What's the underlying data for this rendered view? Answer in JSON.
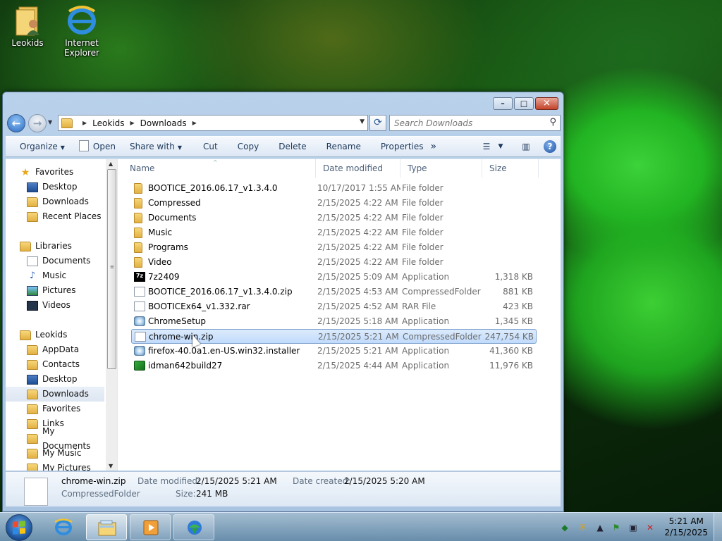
{
  "desktop": {
    "icons": [
      {
        "label": "Leokids",
        "icon": "user-folder-icon"
      },
      {
        "label": "Internet\nExplorer",
        "icon": "internet-explorer-icon"
      }
    ]
  },
  "window": {
    "caption_buttons": {
      "minimize": "–",
      "maximize": "□",
      "close": "✕"
    },
    "nav": {
      "back": "←",
      "forward": "→"
    },
    "address": {
      "crumbs": [
        "Leokids",
        "Downloads"
      ]
    },
    "search": {
      "placeholder": "Search Downloads"
    },
    "toolbar": {
      "organize": "Organize",
      "open": "Open",
      "share_with": "Share with",
      "cut": "Cut",
      "copy": "Copy",
      "delete": "Delete",
      "rename": "Rename",
      "properties": "Properties",
      "more": "»",
      "help": "?"
    },
    "nav_pane": {
      "items": [
        {
          "label": "Favorites",
          "icon": "star-icon",
          "level": 0
        },
        {
          "label": "Desktop",
          "icon": "desktop-icon",
          "level": 1
        },
        {
          "label": "Downloads",
          "icon": "downloads-folder-icon",
          "level": 1
        },
        {
          "label": "Recent Places",
          "icon": "recent-places-icon",
          "level": 1
        },
        {
          "label": "Libraries",
          "icon": "libraries-icon",
          "level": 0
        },
        {
          "label": "Documents",
          "icon": "documents-icon",
          "level": 1
        },
        {
          "label": "Music",
          "icon": "music-icon",
          "level": 1
        },
        {
          "label": "Pictures",
          "icon": "pictures-icon",
          "level": 1
        },
        {
          "label": "Videos",
          "icon": "videos-icon",
          "level": 1
        },
        {
          "label": "Leokids",
          "icon": "user-folder-icon",
          "level": 0
        },
        {
          "label": "AppData",
          "icon": "folder-icon",
          "level": 1
        },
        {
          "label": "Contacts",
          "icon": "contacts-icon",
          "level": 1
        },
        {
          "label": "Desktop",
          "icon": "desktop-icon",
          "level": 1
        },
        {
          "label": "Downloads",
          "icon": "downloads-folder-icon",
          "level": 1,
          "selected": true
        },
        {
          "label": "Favorites",
          "icon": "favorites-folder-icon",
          "level": 1
        },
        {
          "label": "Links",
          "icon": "links-icon",
          "level": 1
        },
        {
          "label": "My Documents",
          "icon": "folder-icon",
          "level": 1
        },
        {
          "label": "My Music",
          "icon": "folder-icon",
          "level": 1
        },
        {
          "label": "My Pictures",
          "icon": "folder-icon",
          "level": 1
        }
      ]
    },
    "columns": {
      "name": "Name",
      "date": "Date modified",
      "type": "Type",
      "size": "Size"
    },
    "files": [
      {
        "name": "BOOTICE_2016.06.17_v1.3.4.0",
        "date": "10/17/2017 1:55 AM",
        "type": "File folder",
        "size": "",
        "icon": "folder-icon"
      },
      {
        "name": "Compressed",
        "date": "2/15/2025 4:22 AM",
        "type": "File folder",
        "size": "",
        "icon": "folder-icon"
      },
      {
        "name": "Documents",
        "date": "2/15/2025 4:22 AM",
        "type": "File folder",
        "size": "",
        "icon": "folder-icon"
      },
      {
        "name": "Music",
        "date": "2/15/2025 4:22 AM",
        "type": "File folder",
        "size": "",
        "icon": "folder-icon"
      },
      {
        "name": "Programs",
        "date": "2/15/2025 4:22 AM",
        "type": "File folder",
        "size": "",
        "icon": "folder-icon"
      },
      {
        "name": "Video",
        "date": "2/15/2025 4:22 AM",
        "type": "File folder",
        "size": "",
        "icon": "folder-icon"
      },
      {
        "name": "7z2409",
        "date": "2/15/2025 5:09 AM",
        "type": "Application",
        "size": "1,318 KB",
        "icon": "7zip-icon"
      },
      {
        "name": "BOOTICE_2016.06.17_v1.3.4.0.zip",
        "date": "2/15/2025 4:53 AM",
        "type": "CompressedFolder",
        "size": "881 KB",
        "icon": "file-icon"
      },
      {
        "name": "BOOTICEx64_v1.332.rar",
        "date": "2/15/2025 4:52 AM",
        "type": "RAR File",
        "size": "423 KB",
        "icon": "file-icon"
      },
      {
        "name": "ChromeSetup",
        "date": "2/15/2025 5:18 AM",
        "type": "Application",
        "size": "1,345 KB",
        "icon": "setup-app-icon"
      },
      {
        "name": "chrome-win.zip",
        "date": "2/15/2025 5:21 AM",
        "type": "CompressedFolder",
        "size": "247,754 KB",
        "icon": "file-icon",
        "selected": true
      },
      {
        "name": "firefox-40.0a1.en-US.win32.installer",
        "date": "2/15/2025 5:21 AM",
        "type": "Application",
        "size": "41,360 KB",
        "icon": "setup-app-icon"
      },
      {
        "name": "idman642build27",
        "date": "2/15/2025 4:44 AM",
        "type": "Application",
        "size": "11,976 KB",
        "icon": "idm-icon"
      }
    ],
    "details": {
      "name": "chrome-win.zip",
      "type": "CompressedFolder",
      "date_modified_label": "Date modified:",
      "date_modified": "2/15/2025 5:21 AM",
      "date_created_label": "Date created:",
      "date_created": "2/15/2025 5:20 AM",
      "size_label": "Size:",
      "size": "241 MB"
    }
  },
  "taskbar": {
    "pinned": [
      "internet-explorer-icon",
      "windows-explorer-icon",
      "media-player-icon",
      "idm-icon"
    ],
    "clock": {
      "time": "5:21 AM",
      "date": "2/15/2025"
    }
  },
  "colors": {
    "selection": "#c1dbfc",
    "window_frame": "#b9d1ea",
    "taskbar": "#7aa0c8"
  }
}
